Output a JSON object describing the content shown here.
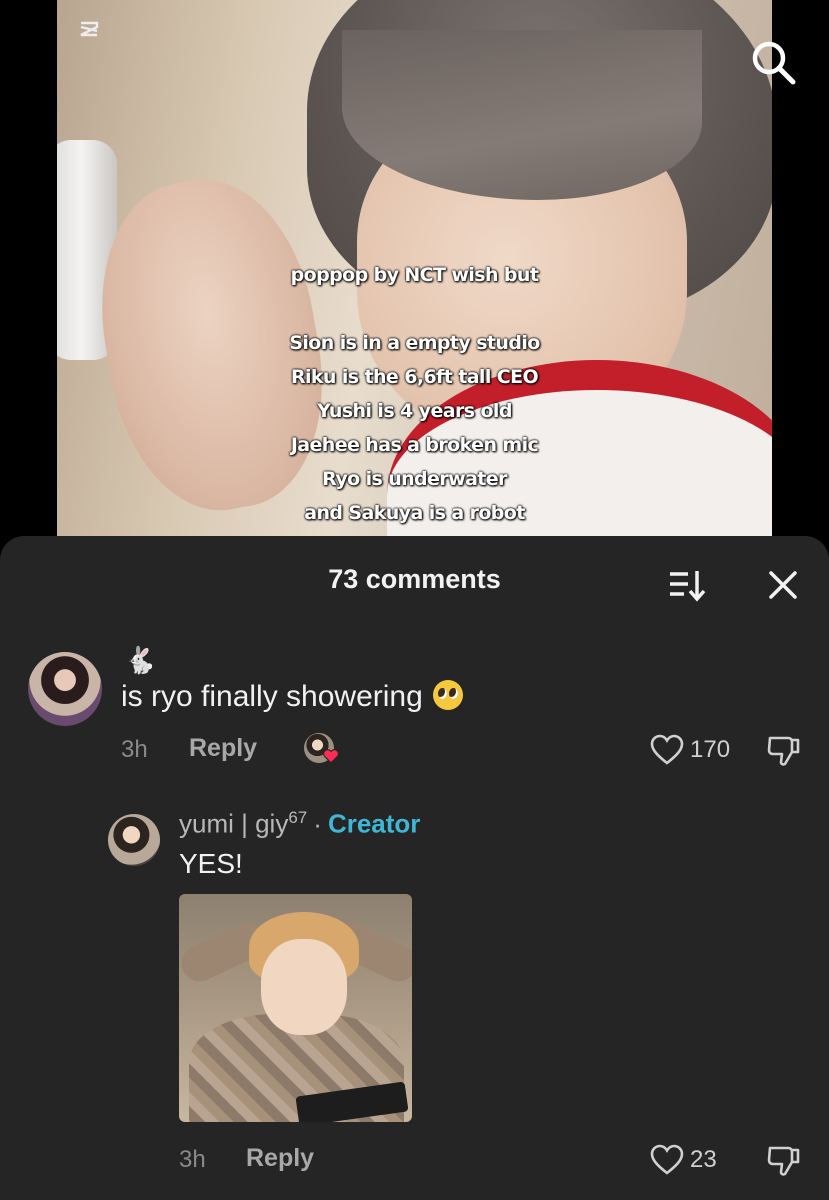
{
  "video": {
    "caption_lines": [
      "poppop by NCT wish but",
      "",
      "Sion is in a empty studio",
      "Riku is the 6,6ft tall CEO",
      "Yushi is 4 years old",
      "Jaehee has a broken mic",
      "Ryo is underwater",
      "and Sakuya is a robot"
    ],
    "icons": {
      "app_logo": "capcut-icon",
      "search": "search-icon"
    }
  },
  "comments_sheet": {
    "title": "73 comments",
    "icons": {
      "sort": "sort-icon",
      "close": "close-icon"
    }
  },
  "comments": [
    {
      "username": "🐇",
      "text": "is ryo finally showering",
      "emoji": "pleading-face-emoji",
      "time": "3h",
      "reply_label": "Reply",
      "liked_by_creator": true,
      "like_count": "170",
      "replies": [
        {
          "username": "yumi | giy",
          "username_sup": "67",
          "separator": "·",
          "badge": "Creator",
          "text": "YES!",
          "has_image": true,
          "time": "3h",
          "reply_label": "Reply",
          "like_count": "23"
        }
      ]
    }
  ],
  "colors": {
    "sheet_background": "#252525",
    "creator_badge": "#3fb6d4",
    "text_primary": "#f1f1f1",
    "text_muted": "#8a8a8a",
    "heart_red": "#fe2c55"
  }
}
